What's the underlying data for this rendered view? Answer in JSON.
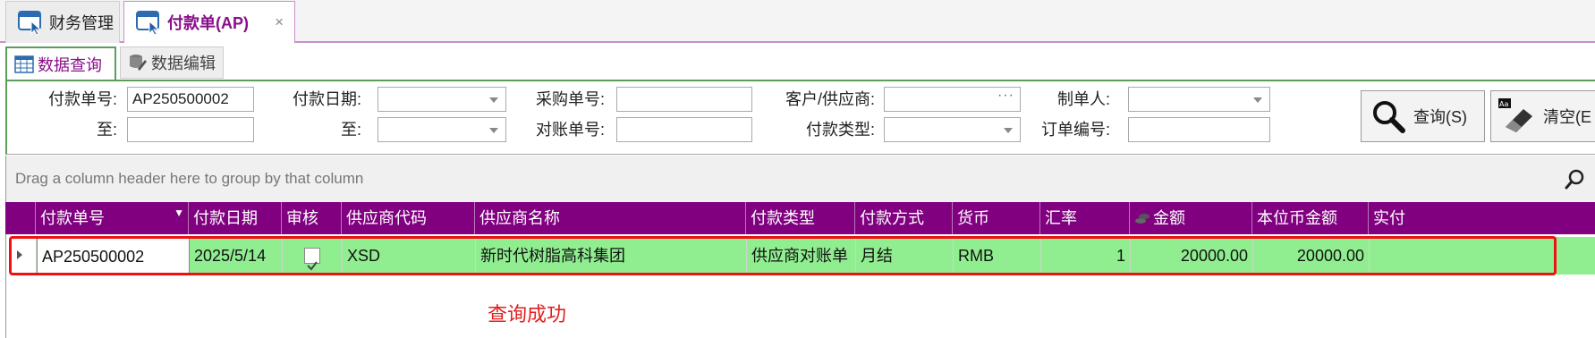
{
  "doc_tabs": [
    {
      "label": "财务管理"
    },
    {
      "label": "付款单(AP)",
      "close": "×"
    }
  ],
  "page_tabs": [
    {
      "label": "数据查询"
    },
    {
      "label": "数据编辑"
    }
  ],
  "query": {
    "payment_no_label": "付款单号:",
    "payment_no_value": "AP250500002",
    "to_label": "至:",
    "payment_date_label": "付款日期:",
    "purchase_no_label": "采购单号:",
    "reconcile_no_label": "对账单号:",
    "customer_supplier_label": "客户/供应商:",
    "payment_type_label": "付款类型:",
    "maker_label": "制单人:",
    "order_no_label": "订单编号:",
    "query_button": "查询(S)",
    "clear_button": "清空(E"
  },
  "grid": {
    "group_hint": "Drag a column header here to group by that column",
    "columns": [
      "付款单号",
      "付款日期",
      "审核",
      "供应商代码",
      "供应商名称",
      "付款类型",
      "付款方式",
      "货币",
      "汇率",
      "金额",
      "本位币金额",
      "实付"
    ],
    "rows": [
      {
        "payment_no": "AP250500002",
        "payment_date": "2025/5/14",
        "audited": true,
        "supplier_code": "XSD",
        "supplier_name": "新时代树脂高科集团",
        "payment_type": "供应商对账单",
        "payment_method": "月结",
        "currency": "RMB",
        "rate": "1",
        "amount": "20000.00",
        "base_amount": "20000.00",
        "paid": ""
      }
    ]
  },
  "annotation": "查询成功",
  "colors": {
    "accent": "#800080",
    "row_highlight": "#90ee90",
    "annotation": "#e02020"
  }
}
